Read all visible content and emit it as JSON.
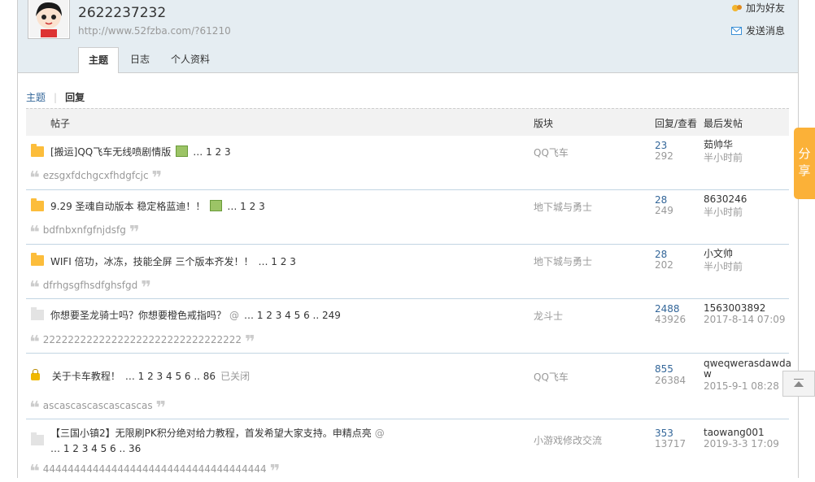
{
  "profile": {
    "username": "2622237232",
    "url": "http://www.52fzba.com/?61210",
    "add_friend": "加为好友",
    "send_message": "发送消息"
  },
  "tabs": [
    "主题",
    "日志",
    "个人资料"
  ],
  "subtabs": {
    "topics": "主题",
    "replies": "回复"
  },
  "table_headers": {
    "post": "帖子",
    "forum": "版块",
    "reply_view": "回复/查看",
    "last_post": "最后发帖"
  },
  "rows": [
    {
      "title": "[搬运]QQ飞车无线喷剧情版",
      "pages": "… 1 2 3",
      "quote": "ezsgxfdchgcxfhdgfcjc",
      "forum": "QQ飞车",
      "replies": "23",
      "views": "292",
      "last_user": "茹帅华",
      "last_time": "半小时前"
    },
    {
      "title": "9.29 圣魂自动版本 稳定格蓝迪！！",
      "pages": "… 1 2 3",
      "quote": "bdfnbxnfgfnjdsfg",
      "forum": "地下城与勇士",
      "replies": "28",
      "views": "249",
      "last_user": "8630246",
      "last_time": "半小时前"
    },
    {
      "title": "WIFI 倍功，冰冻，技能全屏 三个版本齐发！！",
      "pages": "… 1 2 3",
      "quote": "dfrhgsgfhsdfghsfgd",
      "forum": "地下城与勇士",
      "replies": "28",
      "views": "202",
      "last_user": "小文帅",
      "last_time": "半小时前"
    },
    {
      "title": "你想要圣龙骑士吗？你想要橙色戒指吗？",
      "pages": "… 1 2 3 4 5 6 .. 249",
      "quote": "22222222222222222222222222222222",
      "forum": "龙斗士",
      "replies": "2488",
      "views": "43926",
      "last_user": "1563003892",
      "last_time": "2017-8-14 07:09"
    },
    {
      "title": "关于卡车教程！",
      "pages": "… 1 2 3 4 5 6 .. 86",
      "closed": "已关闭",
      "quote": "ascascascascascascas",
      "forum": "QQ飞车",
      "replies": "855",
      "views": "26384",
      "last_user": "qweqwerasdawdaw",
      "last_time": "2015-9-1 08:28"
    },
    {
      "title": "【三国小镇2】无限刷PK积分绝对给力教程，首发希望大家支持。申精点亮",
      "pages": "… 1 2 3 4 5 6 .. 36",
      "quote": "444444444444444444444444444444444444",
      "forum": "小游戏修改交流",
      "replies": "353",
      "views": "13717",
      "last_user": "taowang001",
      "last_time": "2019-3-3 17:09"
    }
  ],
  "share": "分享"
}
